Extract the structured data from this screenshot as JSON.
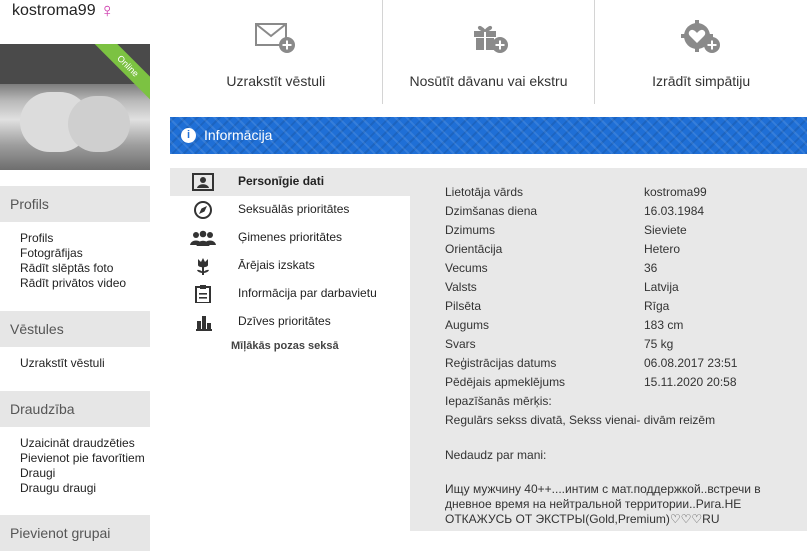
{
  "profile": {
    "username": "kostroma99",
    "gender_icon": "female-sign-icon",
    "online_badge": "Online"
  },
  "sidebar": {
    "sections": [
      {
        "title": "Profils",
        "items": [
          "Profils",
          "Fotogrāfijas",
          "Rādīt slēptās foto",
          "Rādīt privātos video"
        ]
      },
      {
        "title": "Vēstules",
        "items": [
          "Uzrakstīt vēstuli"
        ]
      },
      {
        "title": "Draudzība",
        "items": [
          "Uzaicināt draudzēties",
          "Pievienot pie favorītiem",
          "Draugi",
          "Draugu draugi"
        ]
      },
      {
        "title": "Pievienot grupai"
      }
    ]
  },
  "actions": [
    {
      "label": "Uzrakstīt vēstuli",
      "icon": "envelope-plus-icon"
    },
    {
      "label": "Nosūtīt dāvanu vai ekstru",
      "icon": "gift-plus-icon"
    },
    {
      "label": "Izrādīt simpātiju",
      "icon": "heart-gear-plus-icon"
    }
  ],
  "info_bar": {
    "title": "Informācija",
    "icon": "info-icon"
  },
  "menu": {
    "items": [
      {
        "label": "Personīgie dati",
        "icon": "id-card-icon",
        "active": true
      },
      {
        "label": "Seksuālās prioritātes",
        "icon": "compass-icon",
        "active": false
      },
      {
        "label": "Ģimenes prioritātes",
        "icon": "people-icon",
        "active": false
      },
      {
        "label": "Ārējais izskats",
        "icon": "flower-icon",
        "active": false
      },
      {
        "label": "Informācija par darbavietu",
        "icon": "clipboard-icon",
        "active": false
      },
      {
        "label": "Dzīves prioritātes",
        "icon": "bar-chart-icon",
        "active": false
      }
    ],
    "sub_link": "Mīļākās pozas seksā"
  },
  "details": {
    "rows": [
      {
        "key": "Lietotāja vārds",
        "value": "kostroma99"
      },
      {
        "key": "Dzimšanas diena",
        "value": "16.03.1984"
      },
      {
        "key": "Dzimums",
        "value": "Sieviete"
      },
      {
        "key": "Orientācija",
        "value": "Hetero"
      },
      {
        "key": "Vecums",
        "value": "36"
      },
      {
        "key": "Valsts",
        "value": "Latvija"
      },
      {
        "key": "Pilsēta",
        "value": "Rīga"
      },
      {
        "key": "Augums",
        "value": "183 cm"
      },
      {
        "key": "Svars",
        "value": "75 kg"
      },
      {
        "key": "Reģistrācijas datums",
        "value": "06.08.2017 23:51"
      },
      {
        "key": "Pēdējais apmeklējums",
        "value": "15.11.2020 20:58"
      }
    ],
    "goals_label": "Iepazīšanās mērķis:",
    "goals_value": "Regulārs sekss divatā, Sekss vienai- divām reizēm",
    "about_label": "Nedaudz par mani:",
    "about_text": "Ищу мужчину 40++....интим с мат.поддержкой..встречи в дневное время на нейтральной территории..Рига.НЕ ОТКАЖУСЬ ОТ ЭКСТРЫ(Gold,Premium)♡♡♡RU"
  },
  "colors": {
    "accent_blue": "#1f6fd6",
    "online_green": "#7cc242",
    "gender_pink": "#cc33aa"
  }
}
